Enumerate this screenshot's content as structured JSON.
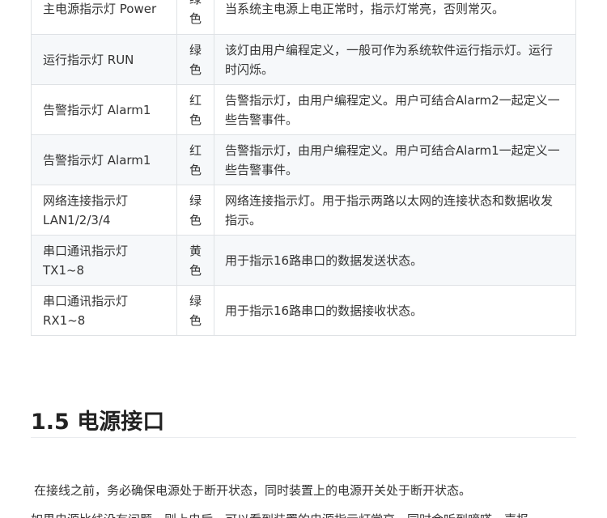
{
  "table": {
    "rows": [
      {
        "name": "主电源指示灯 Power",
        "color": "绿色",
        "desc": "当系统主电源上电正常时，指示灯常亮，否则常灭。"
      },
      {
        "name": "运行指示灯 RUN",
        "color": "绿色",
        "desc": "该灯由用户编程定义，一般可作为系统软件运行指示灯。运行时闪烁。"
      },
      {
        "name": "告警指示灯 Alarm1",
        "color": "红色",
        "desc": "告警指示灯，由用户编程定义。用户可结合Alarm2一起定义一些告警事件。"
      },
      {
        "name": "告警指示灯 Alarm1",
        "color": "红色",
        "desc": "告警指示灯，由用户编程定义。用户可结合Alarm1一起定义一些告警事件。"
      },
      {
        "name": "网络连接指示灯 LAN1/2/3/4",
        "color": "绿色",
        "desc": "网络连接指示灯。用于指示两路以太网的连接状态和数据收发指示。"
      },
      {
        "name": "串口通讯指示灯 TX1~8",
        "color": "黄色",
        "desc": "用于指示16路串口的数据发送状态。"
      },
      {
        "name": "串口通讯指示灯 RX1~8",
        "color": "绿色",
        "desc": "用于指示16路串口的数据接收状态。"
      }
    ]
  },
  "section": {
    "title": "1.5 电源接口",
    "paragraph": "在接线之前，务必确保电源处于断开状态，同时装置上的电源开关处于断开状态。",
    "paragraph_cut": "如果电源比线没有问题，则上电后，可以看到装置的电源指示灯常亮，同时会听到嘀嗒一声报"
  }
}
